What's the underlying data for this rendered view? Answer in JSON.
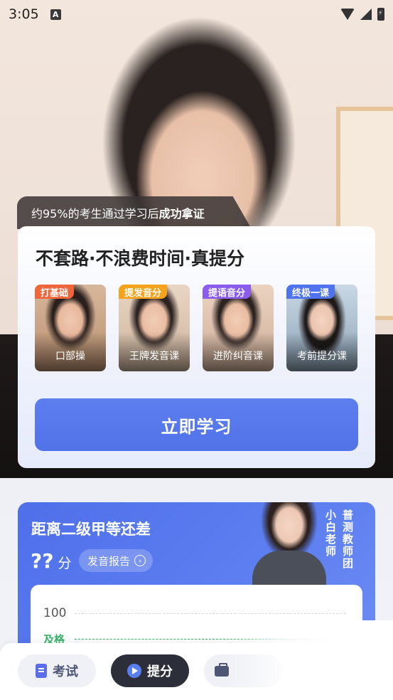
{
  "status_bar": {
    "time": "3:05",
    "notification_glyph": "A"
  },
  "hero": {
    "pass_rate_prefix": "约95%的考生通过学习后",
    "pass_rate_emphasis": "成功拿证"
  },
  "promo_card": {
    "title": "不套路·不浪费时间·真提分",
    "courses": [
      {
        "badge": "打基础",
        "name": "口部操",
        "badge_color": "#f0653a"
      },
      {
        "badge": "提发音分",
        "name": "王牌发音课",
        "badge_color": "#f7a21b"
      },
      {
        "badge": "提语音分",
        "name": "进阶纠音课",
        "badge_color": "#8b5cf0"
      },
      {
        "badge": "终极一课",
        "name": "考前提分课",
        "badge_color": "#4f72ee"
      }
    ],
    "cta_label": "立即学习"
  },
  "score_card": {
    "title": "距离二级甲等还差",
    "value": "??",
    "unit": "分",
    "report_label": "发音报告",
    "teacher_name": "小白老师",
    "team_label": "普测教师团",
    "chart_ticks": {
      "top": "100",
      "pass": "及格"
    }
  },
  "bottom_nav": {
    "items": [
      {
        "label": "考试",
        "icon": "document-icon"
      },
      {
        "label": "提分",
        "icon": "play-icon"
      },
      {
        "label": "",
        "icon": "briefcase-icon"
      }
    ]
  },
  "colors": {
    "accent": "#5173e8",
    "pass_green": "#3bb36a",
    "nav_active": "#2c2f3a"
  }
}
